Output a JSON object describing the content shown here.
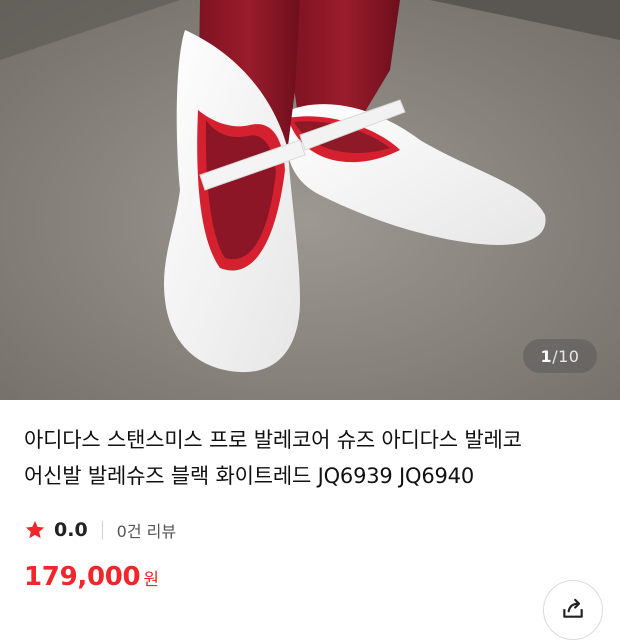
{
  "product_image": {
    "alt": "",
    "counter": {
      "current": "1",
      "separator": "/",
      "total": "10"
    }
  },
  "product": {
    "title_line1": "아디다스 스탠스미스 프로 발레코어 슈즈 아디다스 발레코",
    "title_line2": "어신발 발레슈즈 블랙 화이트레드 JQ6939 JQ6940",
    "rating": "0.0",
    "review_count": "0건 리뷰",
    "price": "179,000",
    "currency": "원"
  },
  "icons": {
    "star": "star-icon",
    "share": "share-icon"
  },
  "colors": {
    "accent": "#f0262b",
    "text": "#111111",
    "muted": "#555555"
  }
}
